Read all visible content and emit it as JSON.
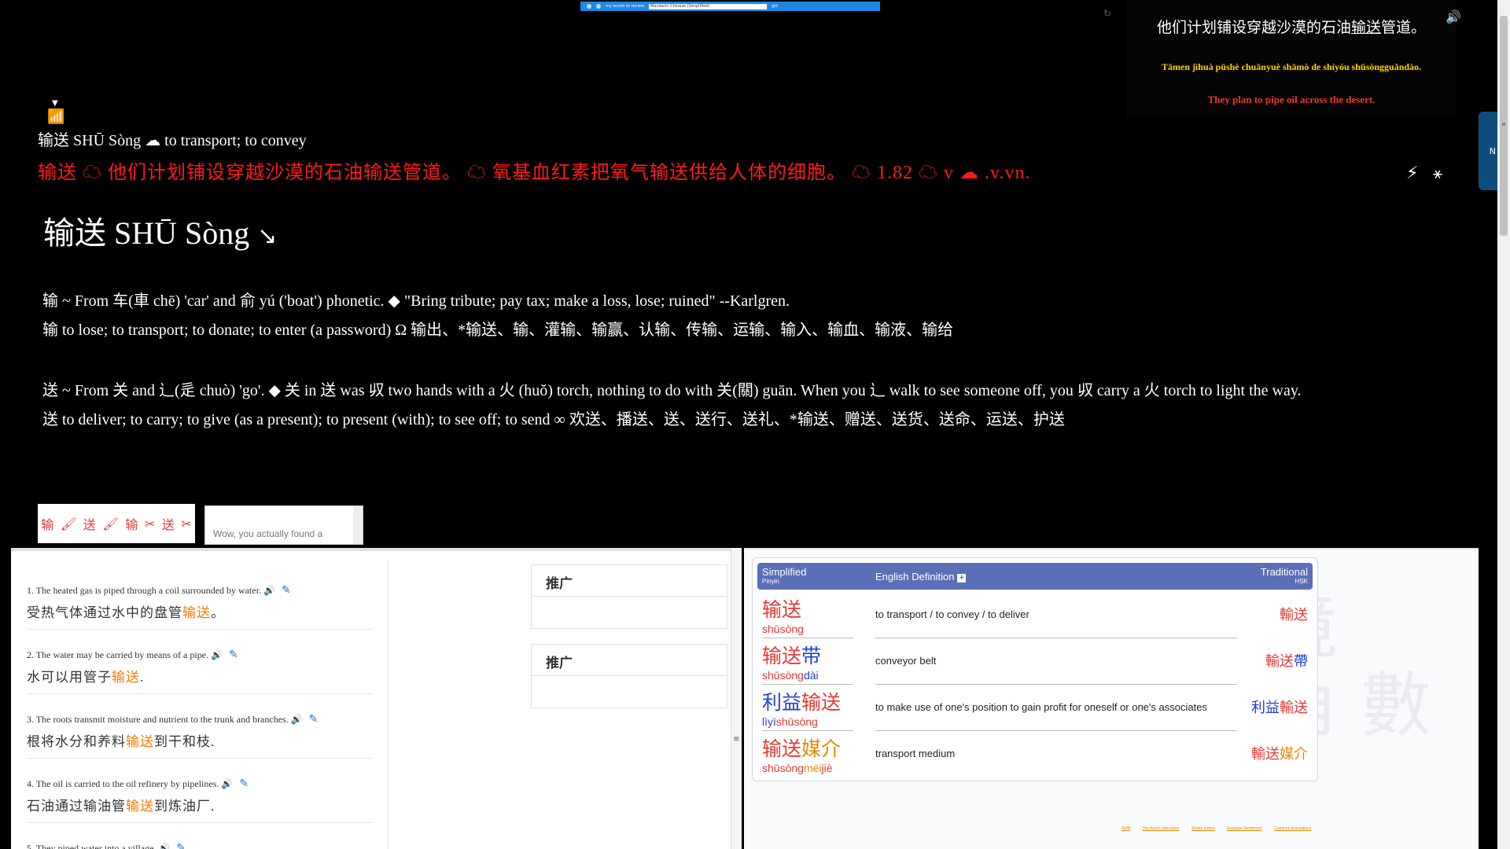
{
  "topbar": {
    "title": "my words to review",
    "field": "Mandarin Chinese (Simplified)",
    "btn": "gid"
  },
  "refresh_icon": "refresh-icon",
  "example": {
    "cn_before": "他们计划铺设穿越沙漠的石油",
    "cn_word": "输送",
    "cn_after": "管道。",
    "pinyin": "Tāmen jìhuà pūshè chuānyuè shāmò de shíyóu shūsòngguǎndào.",
    "english": "They plan to pipe oil across the desert."
  },
  "side_tab": {
    "label": "N"
  },
  "line1": "输送 SHŪ Sòng ☁ to transport; to convey",
  "line2": "输送 ☁ 他们计划铺设穿越沙漠的石油输送管道。 ☁ 氧基血红素把氧气输送供给人体的细胞。 ☁ 1.82 ☁ v ☁ .v.vn.",
  "title": {
    "text": "输送 SHŪ Sòng",
    "arrow": "↘"
  },
  "etymology": [
    "输 ~ From 车(車 chē) 'car' and 俞 yú ('boat') phonetic. ◆ \"Bring tribute; pay tax; make a loss, lose; ruined\" --Karlgren.",
    "输 to lose; to transport; to donate; to enter (a password) Ω 输出、*输送、输、灌输、输赢、认输、传输、运输、输入、输血、输液、输给",
    "送 ~ From 关 and 辶(辵 chuò) 'go'. ◆ 关 in 送 was 𠬞 two hands with a 火 (huǒ) torch, nothing to do with 关(關) guān. When you 辶 walk to see someone off, you 𠬞 carry a 火 torch to light the way.",
    "送 to deliver; to carry; to give (as a present); to present (with); to see off; to send ∞ 欢送、播送、送、送行、送礼、*输送、赠送、送货、送命、运送、护送"
  ],
  "thumbs": [
    "输",
    "送",
    "输",
    "送"
  ],
  "textbox": {
    "text": "Wow, you actually found a"
  },
  "sentences": [
    {
      "en": "1. The heated gas is piped through a coil surrounded by water.",
      "cn_before": "受热气体通过水中的盘管",
      "cn_hl": "输送",
      "cn_after": "。"
    },
    {
      "en": "2. The water may be carried by means of a pipe.",
      "cn_before": "水可以用管子",
      "cn_hl": "输送",
      "cn_after": "."
    },
    {
      "en": "3. The roots transmit moisture and nutrient to the trunk and branches.",
      "cn_before": "根将水分和养料",
      "cn_hl": "输送",
      "cn_after": "到干和枝."
    },
    {
      "en": "4. The oil is carried to the oil refinery by pipelines.",
      "cn_before": "石油通过输油管",
      "cn_hl": "输送",
      "cn_after": "到炼油厂."
    },
    {
      "en": "5. They piped water into a village.",
      "cn_before": "",
      "cn_hl": "",
      "cn_after": ""
    }
  ],
  "promo": [
    "推广",
    "推广"
  ],
  "dict": {
    "head": {
      "simplified": "Simplified",
      "pinyin": "Pinyin",
      "definition": "English Definition",
      "plus": "+",
      "traditional": "Traditional",
      "hsk": "HSK"
    },
    "rows": [
      {
        "hz": [
          [
            "输送",
            "red"
          ]
        ],
        "py": [
          [
            "shūsòng",
            "red"
          ]
        ],
        "def": "to transport / to convey / to deliver",
        "tr": [
          [
            "輸送",
            "red"
          ]
        ]
      },
      {
        "hz": [
          [
            "输送",
            "red"
          ],
          [
            "带",
            "blue"
          ]
        ],
        "py": [
          [
            "shūsòng",
            "red"
          ],
          [
            "dài",
            "blue"
          ]
        ],
        "def": "conveyor belt",
        "tr": [
          [
            "輸送",
            "red"
          ],
          [
            "帶",
            "blue"
          ]
        ]
      },
      {
        "hz": [
          [
            "利益",
            "blue"
          ],
          [
            "输送",
            "red"
          ]
        ],
        "py": [
          [
            "lìyì",
            "blue"
          ],
          [
            "shūsòng",
            "red"
          ]
        ],
        "def": "to make use of one's position to gain profit for oneself or one's associates",
        "tr": [
          [
            "利益",
            "blue"
          ],
          [
            "輸送",
            "red"
          ]
        ]
      },
      {
        "hz": [
          [
            "输送",
            "red"
          ],
          [
            "媒",
            "orange"
          ],
          [
            "介",
            "orange"
          ]
        ],
        "py": [
          [
            "shūsòng",
            "red"
          ],
          [
            "mèi",
            "orange"
          ],
          [
            "jiè",
            "red"
          ]
        ],
        "def": "transport medium",
        "tr": [
          [
            "輸送",
            "red"
          ],
          [
            "媒介",
            "orange"
          ]
        ]
      }
    ]
  },
  "footer_links": [
    "Refill",
    "You found characters",
    "Stroke orders",
    "Example Sentences",
    "Common translations"
  ],
  "colors": {
    "accent": "#5a6fb8",
    "highlight": "#f57c00",
    "headword": "#ff1a1a"
  }
}
